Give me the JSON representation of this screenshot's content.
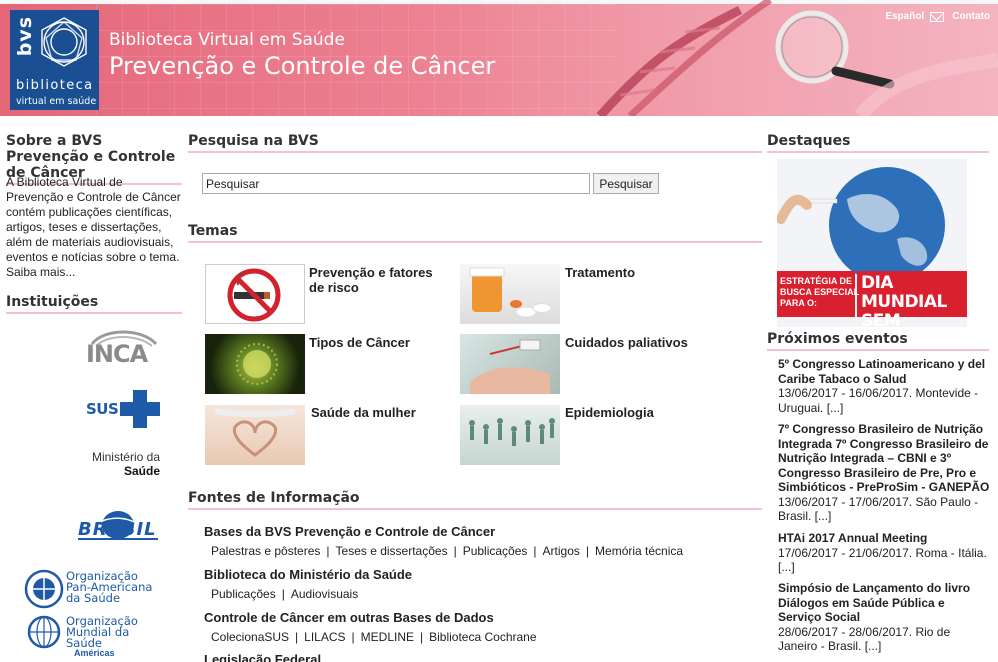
{
  "header": {
    "logo_letters": "bvs",
    "logo_word": "biblioteca",
    "logo_sub": "virtual em saúde",
    "title_small": "Biblioteca Virtual em Saúde",
    "title_big": "Prevenção e Controle de Câncer",
    "link_espanol": "Español",
    "link_contato": "Contato"
  },
  "left": {
    "about_heading": "Sobre a BVS Prevenção e Controle de Câncer",
    "about_text": "A Biblioteca Virtual de Prevenção e Controle de Câncer contém publicações científicas, artigos, teses e dissertações, além de materiais audiovisuais, eventos e notícias sobre o tema. Saiba mais...",
    "inst_heading": "Instituições",
    "inst": {
      "inca": "INCA",
      "sus": "SUS",
      "ministerio_1": "Ministério da",
      "ministerio_2": "Saúde",
      "brasil": "BRASIL",
      "opas_1": "Organização",
      "opas_2": "Pan-Americana",
      "opas_3": "da Saúde",
      "oms_1": "Organização",
      "oms_2": "Mundial da Saúde",
      "oms_3": "Américas"
    }
  },
  "search": {
    "heading": "Pesquisa na BVS",
    "value": "Pesquisar",
    "button": "Pesquisar"
  },
  "temas": {
    "heading": "Temas",
    "items": [
      {
        "label": "Prevenção e fatores de risco"
      },
      {
        "label": "Tratamento"
      },
      {
        "label": "Tipos de Câncer"
      },
      {
        "label": "Cuidados paliativos"
      },
      {
        "label": "Saúde da mulher"
      },
      {
        "label": "Epidemiologia"
      }
    ]
  },
  "fontes": {
    "heading": "Fontes de Informação",
    "groups": [
      {
        "title": "Bases da BVS Prevenção e Controle de Câncer",
        "links": [
          "Palestras e pôsteres",
          "Teses e dissertações",
          "Publicações",
          "Artigos",
          "Memória técnica"
        ]
      },
      {
        "title": "Biblioteca do Ministério da Saúde",
        "links": [
          "Publicações",
          "Audiovisuais"
        ]
      },
      {
        "title": "Controle de Câncer em outras Bases de Dados",
        "links": [
          "ColecionaSUS",
          "LILACS",
          "MEDLINE",
          "Biblioteca Cochrane"
        ]
      },
      {
        "title": "Legislação Federal",
        "links": []
      }
    ]
  },
  "right": {
    "destaques_heading": "Destaques",
    "banner_left_1": "ESTRATÉGIA DE",
    "banner_left_2": "BUSCA ESPECIAL",
    "banner_left_3": "PARA O:",
    "banner_right_1": "DIA MUNDIAL",
    "banner_right_2": "SEM TABACO",
    "eventos_heading": "Próximos eventos",
    "events": [
      {
        "title": "5º Congresso Latinoamericano y del Caribe Tabaco o Salud",
        "detail": "13/06/2017 - 16/06/2017. Montevide - Uruguai. [...]"
      },
      {
        "title": "7º Congresso Brasileiro de Nutrição Integrada 7º Congresso Brasileiro de Nutrição Integrada – CBNI e 3º Congresso Brasileiro de Pre, Pro e Simbióticos - PreProSim - GANEPÃO",
        "detail": "13/06/2017 - 17/06/2017. São Paulo - Brasil. [...]"
      },
      {
        "title": "HTAi 2017 Annual Meeting",
        "detail": "17/06/2017 - 21/06/2017. Roma - Itália. [...]"
      },
      {
        "title": "Simpósio de Lançamento do livro Diálogos em Saúde Pública e Serviço Social",
        "detail": "28/06/2017 - 28/06/2017. Rio de Janeiro - Brasil. [...]"
      }
    ]
  },
  "colors": {
    "header_pink": "#e4677a",
    "logo_blue": "#1a4f93",
    "heading_rule": "#f3c2ca",
    "banner_red": "#d8202f"
  }
}
